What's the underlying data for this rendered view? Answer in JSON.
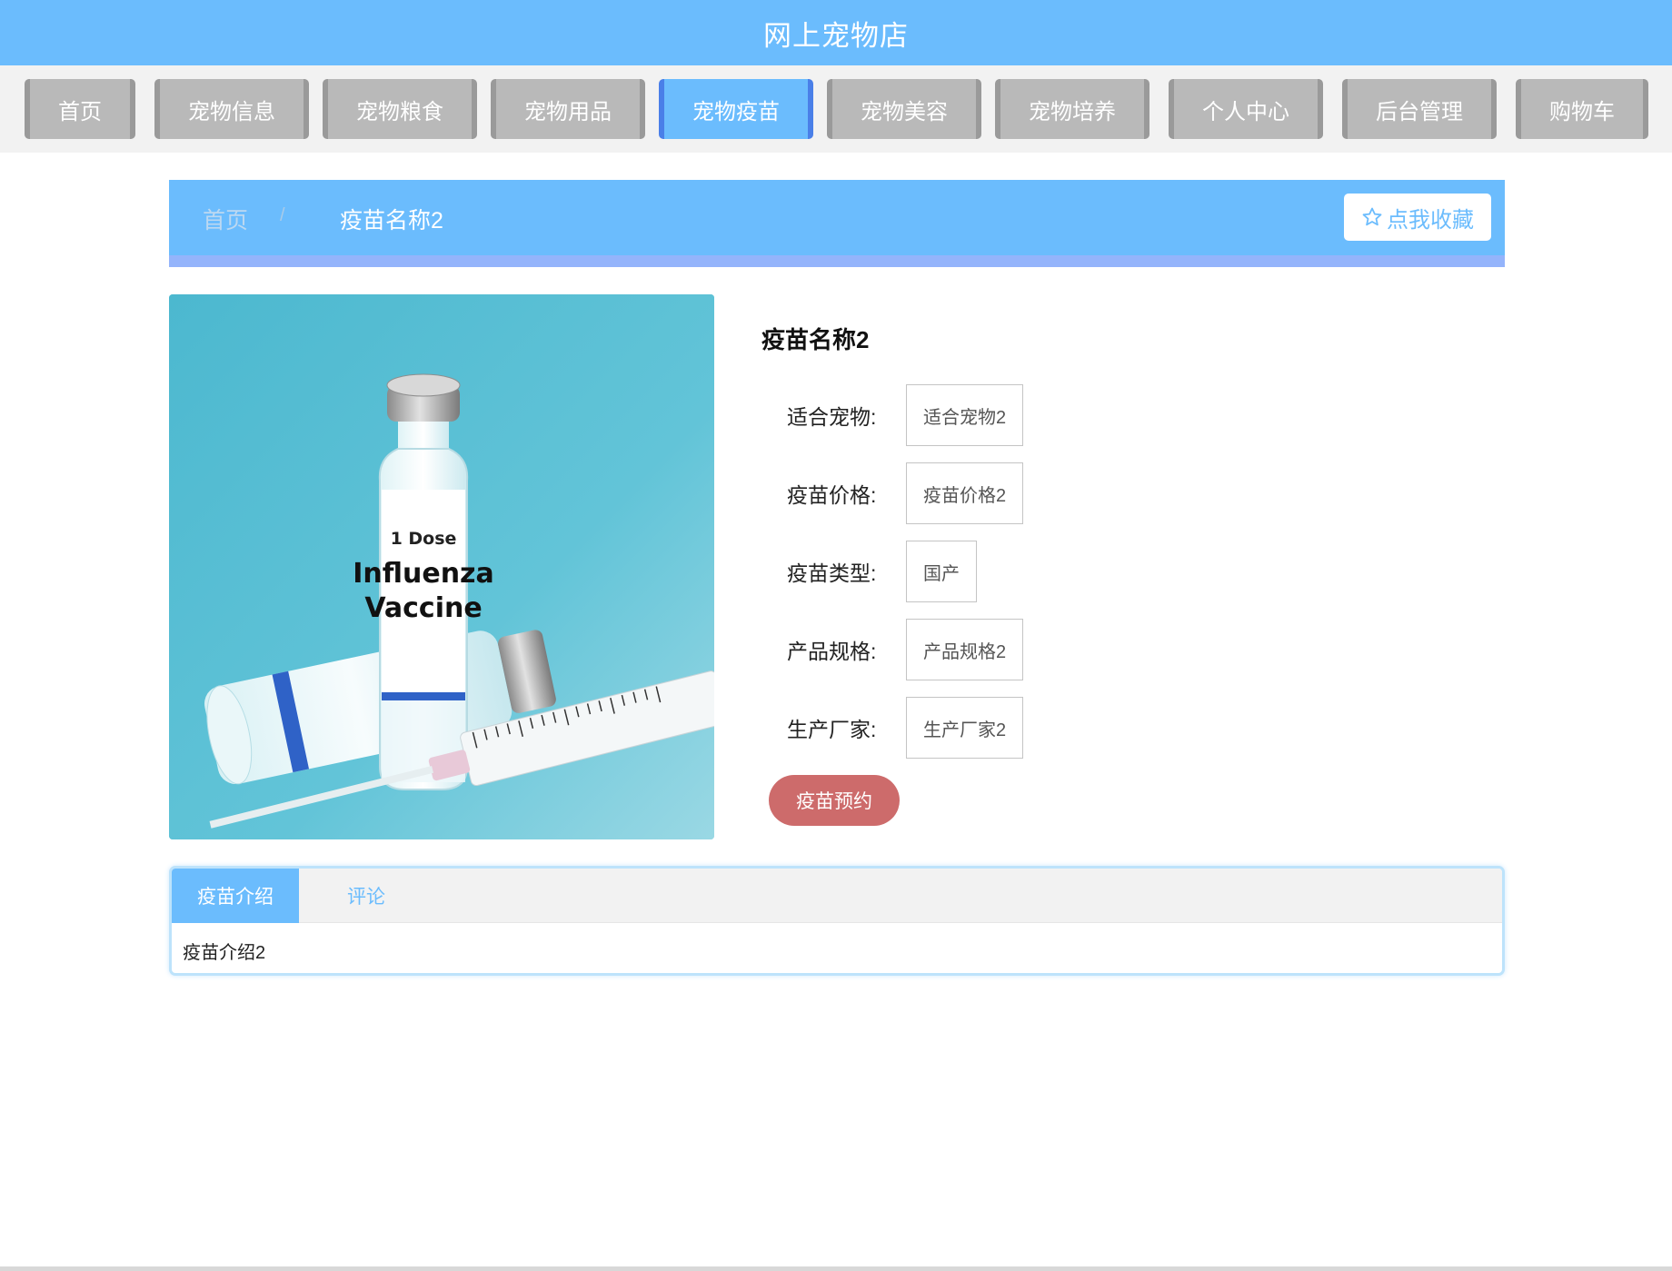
{
  "header": {
    "title": "网上宠物店"
  },
  "nav": {
    "items": [
      {
        "label": "首页"
      },
      {
        "label": "宠物信息"
      },
      {
        "label": "宠物粮食"
      },
      {
        "label": "宠物用品"
      },
      {
        "label": "宠物疫苗"
      },
      {
        "label": "宠物美容"
      },
      {
        "label": "宠物培养"
      },
      {
        "label": "个人中心"
      },
      {
        "label": "后台管理"
      },
      {
        "label": "购物车"
      }
    ],
    "active": "宠物疫苗"
  },
  "breadcrumb": {
    "home": "首页",
    "separator": "/",
    "current": "疫苗名称2"
  },
  "favorite_button": {
    "label": "点我收藏",
    "icon": "star-outline-icon"
  },
  "product": {
    "image_label": {
      "dose": "1 Dose",
      "line1": "Influenza",
      "line2": "Vaccine"
    },
    "name": "疫苗名称2",
    "fields": [
      {
        "label": "适合宠物:",
        "value": "适合宠物2"
      },
      {
        "label": "疫苗价格:",
        "value": "疫苗价格2"
      },
      {
        "label": "疫苗类型:",
        "value": "国产"
      },
      {
        "label": "产品规格:",
        "value": "产品规格2"
      },
      {
        "label": "生产厂家:",
        "value": "生产厂家2"
      }
    ],
    "book_button": "疫苗预约"
  },
  "tabs": {
    "items": [
      {
        "label": "疫苗介绍"
      },
      {
        "label": "评论"
      }
    ],
    "active": "疫苗介绍",
    "content": "疫苗介绍2"
  },
  "colors": {
    "primary": "#6bbcfd",
    "nav_inactive": "#b9b9b9",
    "book_button": "#cd6b6b"
  }
}
